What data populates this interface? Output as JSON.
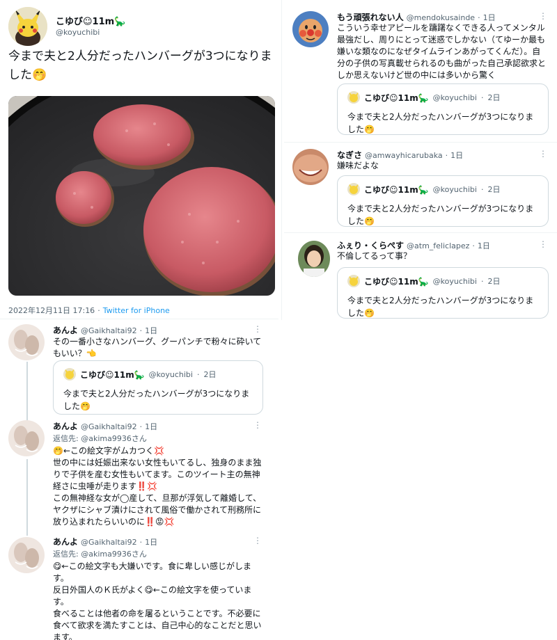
{
  "main_tweet": {
    "author_name": "こゆび☺11m🦕",
    "author_handle": "@koyuchibi",
    "text": "今まで夫と2人分だったハンバーグが3つになりました🤭",
    "timestamp": "2022年12月11日 17:16",
    "via": "Twitter for iPhone"
  },
  "quoted_tweet": {
    "author_name": "こゆび☺11m🦕",
    "author_handle": "@koyuchibi",
    "age": "2日",
    "text": "今まで夫と2人分だったハンバーグが3つになりました🤭"
  },
  "left_replies": [
    {
      "name": "あんよ",
      "handle": "@Gaikhaltai92",
      "age": "1日",
      "text": "その一番小さなハンバーグ、グーパンチで粉々に砕いてもいい？👈"
    },
    {
      "name": "あんよ",
      "handle": "@Gaikhaltai92",
      "age": "1日",
      "reply_to": "返信先: @akima9936さん",
      "text": "🤭←この絵文字がムカつく💢\n世の中には妊娠出来ない女性もいてるし、独身のまま独りで子供を産む女性もいてます。このツイート主の無神経さに虫唾が走ります‼️💢\nこの無神経な女が◯産して、旦那が浮気して離婚して、ヤクザにシャブ漬けにされて風俗で働かされて刑務所に放り込まれたらいいのに‼️😡💢"
    },
    {
      "name": "あんよ",
      "handle": "@Gaikhaltai92",
      "age": "1日",
      "reply_to": "返信先: @akima9936さん",
      "text": "😋←この絵文字も大嫌いです。食に卑しい感じがします。\n反日外国人のＫ氏がよく😋←この絵文字を使っています。\n食べることは他者の命を屠るということです。不必要に食べて欲求を満たすことは、自己中心的なことだと思います。"
    }
  ],
  "right_replies": [
    {
      "name": "もう頑張れない人",
      "handle": "@mendokusainde",
      "age": "1日",
      "text": "こういう幸せアピールを躊躇なくできる人ってメンタル最強だし、周りにとって迷惑でしかない（てゆーか最も嫌いな類なのになぜタイムラインあがってくんだ）。自分の子供の写真載せられるのも曲がった自己承認欲求としか思えないけど世の中には多いから驚く"
    },
    {
      "name": "なぎさ",
      "handle": "@amwayhicarubaka",
      "age": "1日",
      "text": "嫌味だよな"
    },
    {
      "name": "ふぇり・くらぺす",
      "handle": "@atm_feliclapez",
      "age": "1日",
      "text": "不倫してるって事？"
    }
  ],
  "colors": {
    "link": "#1d9bf0",
    "secondary": "#536471",
    "border": "#cfd9de"
  }
}
